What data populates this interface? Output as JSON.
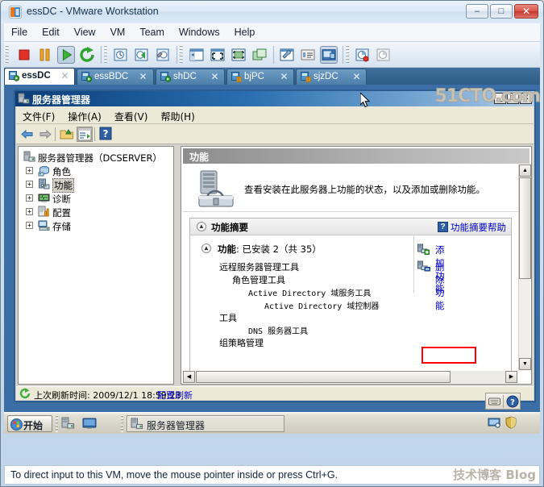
{
  "vmware": {
    "title": "essDC - VMware Workstation",
    "title_icon": "vmware-app-icon",
    "caption": {
      "minimize": "–",
      "maximize": "□",
      "close": "✕"
    },
    "menu": [
      "File",
      "Edit",
      "View",
      "VM",
      "Team",
      "Windows",
      "Help"
    ],
    "toolbar": [
      {
        "name": "power-off-icon",
        "state": "normal"
      },
      {
        "name": "suspend-icon",
        "state": "normal"
      },
      {
        "name": "power-on-icon",
        "state": "pressed"
      },
      {
        "name": "reset-icon",
        "state": "normal"
      },
      {
        "name": "snapshot-take-icon",
        "state": "normal"
      },
      {
        "name": "snapshot-revert-icon",
        "state": "normal"
      },
      {
        "name": "snapshot-manager-icon",
        "state": "normal"
      },
      {
        "name": "show-sidebar-icon",
        "state": "normal"
      },
      {
        "name": "fullscreen-icon",
        "state": "normal"
      },
      {
        "name": "quick-switch-icon",
        "state": "normal"
      },
      {
        "name": "unity-icon",
        "state": "normal"
      },
      {
        "name": "vm-settings-icon",
        "state": "normal"
      },
      {
        "name": "vm-summary-icon",
        "state": "normal"
      },
      {
        "name": "vm-console-icon",
        "state": "pressed"
      },
      {
        "name": "team-connect-icon",
        "state": "normal"
      },
      {
        "name": "team-disconnect-icon",
        "state": "normal"
      }
    ],
    "tabs": [
      {
        "label": "essDC",
        "icon": "vm-running-icon",
        "active": true
      },
      {
        "label": "essBDC",
        "icon": "vm-running-icon",
        "active": false
      },
      {
        "label": "shDC",
        "icon": "vm-running-icon",
        "active": false
      },
      {
        "label": "bjPC",
        "icon": "vm-suspended-icon",
        "active": false
      },
      {
        "label": "sjzDC",
        "icon": "vm-suspended-icon",
        "active": false
      }
    ],
    "tab_close_glyph": "✕",
    "hint": "To direct input to this VM, move the mouse pointer inside or press Ctrl+G."
  },
  "server_manager": {
    "title": "服务器管理器",
    "title_icon": "server-manager-icon",
    "caption": {
      "minimize": "_",
      "maximize": "□",
      "close": "✕"
    },
    "menu": [
      "文件(F)",
      "操作(A)",
      "查看(V)",
      "帮助(H)"
    ],
    "toolbar": [
      {
        "name": "back-arrow-icon"
      },
      {
        "name": "forward-arrow-icon"
      },
      {
        "name": "up-folder-icon"
      },
      {
        "name": "show-hide-console-tree-icon"
      },
      {
        "name": "help-icon"
      }
    ],
    "tree": [
      {
        "label": "服务器管理器（DCSERVER）",
        "icon": "server-root-icon",
        "indent": 0,
        "expander": "",
        "selected": false
      },
      {
        "label": "角色",
        "icon": "roles-icon",
        "indent": 1,
        "expander": "+",
        "selected": false
      },
      {
        "label": "功能",
        "icon": "features-icon",
        "indent": 1,
        "expander": "+",
        "selected": true
      },
      {
        "label": "诊断",
        "icon": "diagnostics-icon",
        "indent": 1,
        "expander": "+",
        "selected": false
      },
      {
        "label": "配置",
        "icon": "configuration-icon",
        "indent": 1,
        "expander": "+",
        "selected": false
      },
      {
        "label": "存储",
        "icon": "storage-icon",
        "indent": 1,
        "expander": "+",
        "selected": false
      }
    ],
    "detail": {
      "header": "功能",
      "intro_icon": "toolbox-icon",
      "intro_text": "查看安装在此服务器上功能的状态，以及添加或删除功能。",
      "summary": {
        "title": "功能摘要",
        "help_icon": "help-question-icon",
        "help_link": "功能摘要帮助",
        "count_label": "功能",
        "count_value": "已安装 2（共 35）",
        "features": [
          {
            "text": "远程服务器管理工具",
            "indent": 0,
            "mono": false
          },
          {
            "text": "角色管理工具",
            "indent": 1,
            "mono": false
          },
          {
            "text": "Active Directory 域服务工具",
            "indent": 2,
            "mono": true
          },
          {
            "text": "Active Directory 域控制器",
            "indent": 3,
            "mono": true
          },
          {
            "text": "工具",
            "indent": 0,
            "mono": false
          },
          {
            "text": "DNS 服务器工具",
            "indent": 2,
            "mono": true
          },
          {
            "text": "组策略管理",
            "indent": 0,
            "mono": false
          }
        ],
        "actions": [
          {
            "label": "添加功能",
            "icon": "add-feature-icon",
            "highlighted": true
          },
          {
            "label": "删除功能",
            "icon": "remove-feature-icon",
            "highlighted": false
          }
        ]
      }
    },
    "statusbar": {
      "icon": "refresh-icon",
      "text": "上次刷新时间: 2009/12/1 18:59:23",
      "link": "配置刷新"
    },
    "scrollbars": {
      "up_arrow": "▲",
      "down_arrow": "▼",
      "left_arrow": "◀",
      "right_arrow": "▶"
    }
  },
  "guest_taskbar": {
    "start_label": "开始",
    "start_icon": "windows-logo-icon",
    "quick_launch": [
      {
        "name": "server-manager-quicklaunch-icon"
      },
      {
        "name": "show-desktop-icon"
      }
    ],
    "task_button": {
      "label": "服务器管理器",
      "icon": "server-manager-icon"
    },
    "tray": [
      {
        "name": "network-icon"
      },
      {
        "name": "security-shield-icon"
      }
    ]
  },
  "floating_tools": [
    {
      "name": "onscreen-keyboard-icon"
    },
    {
      "name": "help-blue-icon"
    }
  ],
  "watermark": {
    "site": "51CTO.com",
    "blog": "技术博客 Blog"
  },
  "colors": {
    "vmware_chrome": "#d9e6f2",
    "tab_active_bg": "#ffffff",
    "mmc_title_start": "#0b3d78",
    "highlight_red": "#ff0000",
    "link_blue": "#0000c8",
    "desktop_blue": "#3b6ea5"
  }
}
